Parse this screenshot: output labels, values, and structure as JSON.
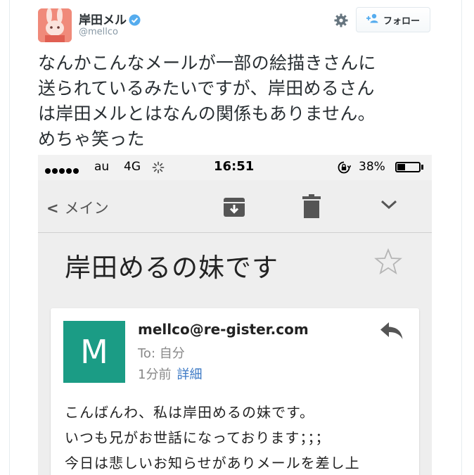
{
  "tweet": {
    "display_name": "岸田メル",
    "handle": "@mellco",
    "follow_label": "フォロー",
    "text_lines": [
      "なんかこんなメールが一部の絵描きさんに",
      "送られているみたいですが、岸田めるさん",
      "は岸田メルとはなんの関係もありません。",
      "めちゃ笑った"
    ]
  },
  "phone": {
    "status_bar": {
      "carrier": "au",
      "network": "4G",
      "time": "16:51",
      "battery": "38%",
      "battery_level": 0.38
    },
    "toolbar": {
      "back_label": "メイン"
    },
    "subject": "岸田めるの妹です",
    "mail": {
      "avatar_letter": "M",
      "sender": "mellco@re-gister.com",
      "to": "To: 自分",
      "time": "1分前",
      "details": "詳細",
      "body_lines": [
        "こんばんわ、私は岸田めるの妹です。",
        "いつも兄がお世話になっております；；；",
        "今日は悲しいお知らせがありメールを差し上"
      ]
    }
  },
  "colors": {
    "verified": "#55acee",
    "mail_avatar": "#1b9c85",
    "link": "#3b78c4"
  }
}
